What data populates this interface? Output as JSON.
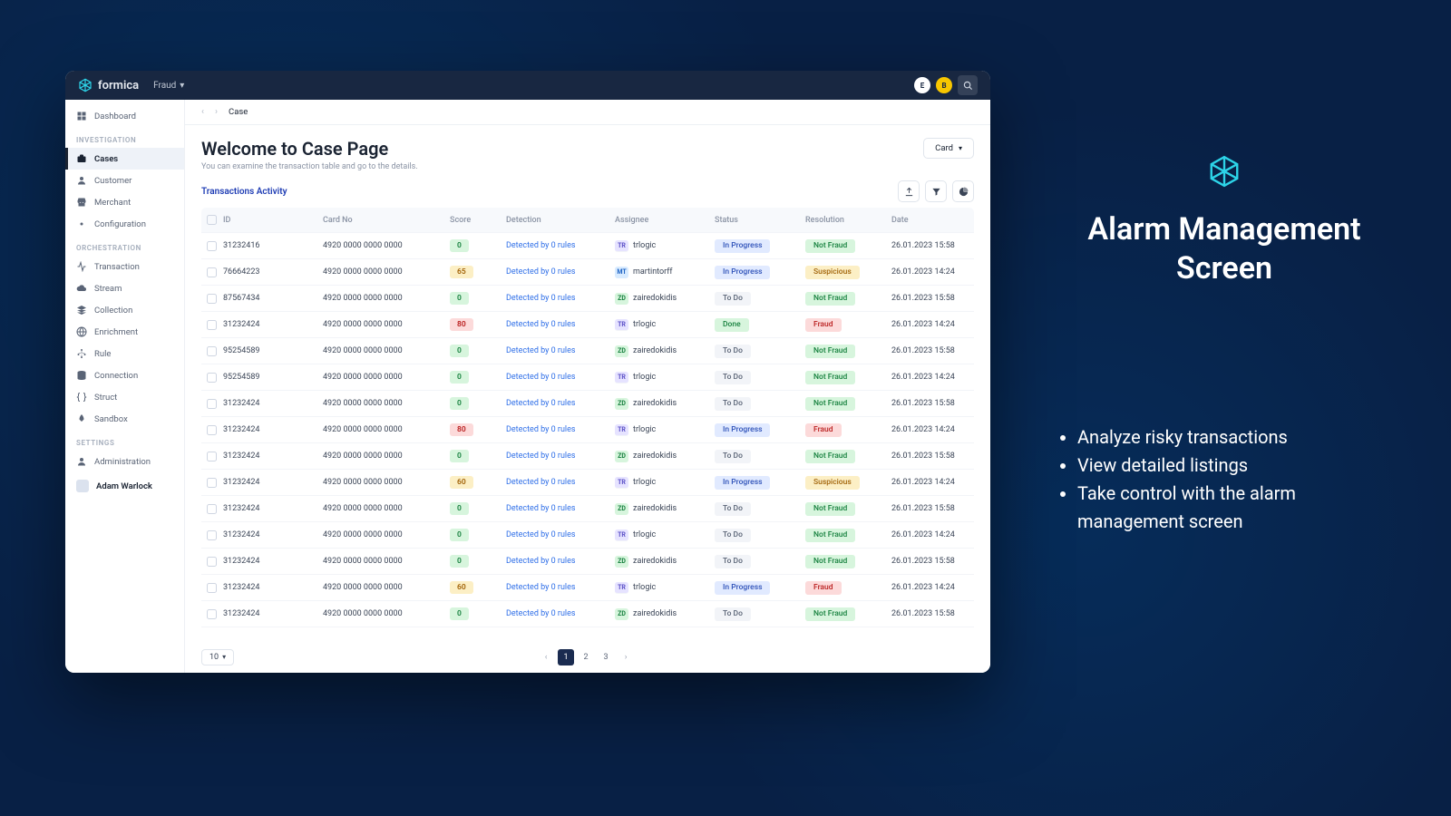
{
  "brand": "formica",
  "top_menu": {
    "label": "Fraud"
  },
  "topbar_pills": [
    "E",
    "B"
  ],
  "sidebar": {
    "groups": [
      {
        "header": null,
        "items": [
          {
            "label": "Dashboard",
            "icon": "dashboard"
          }
        ]
      },
      {
        "header": "INVESTIGATION",
        "items": [
          {
            "label": "Cases",
            "icon": "briefcase",
            "active": true
          },
          {
            "label": "Customer",
            "icon": "user"
          },
          {
            "label": "Merchant",
            "icon": "store"
          },
          {
            "label": "Configuration",
            "icon": "gear"
          }
        ]
      },
      {
        "header": "ORCHESTRATION",
        "items": [
          {
            "label": "Transaction",
            "icon": "activity"
          },
          {
            "label": "Stream",
            "icon": "cloud"
          },
          {
            "label": "Collection",
            "icon": "layers"
          },
          {
            "label": "Enrichment",
            "icon": "globe"
          },
          {
            "label": "Rule",
            "icon": "tree"
          },
          {
            "label": "Connection",
            "icon": "db"
          },
          {
            "label": "Struct",
            "icon": "braces"
          },
          {
            "label": "Sandbox",
            "icon": "rocket"
          }
        ]
      },
      {
        "header": "SETTINGS",
        "items": [
          {
            "label": "Administration",
            "icon": "user"
          }
        ]
      }
    ],
    "user": "Adam Warlock"
  },
  "breadcrumb": "Case",
  "page": {
    "title": "Welcome to Case Page",
    "subtitle": "You can examine the transaction table and go to the details.",
    "dropdown": "Card"
  },
  "section_title": "Transactions Activity",
  "columns": [
    "ID",
    "Card No",
    "Score",
    "Detection",
    "Assignee",
    "Status",
    "Resolution",
    "Date"
  ],
  "rows": [
    {
      "id": "31232416",
      "card": "4920 0000 0000 0000",
      "score": 0,
      "score_cls": "g",
      "detect": "Detected by 0 rules",
      "assignee": {
        "tag": "TR",
        "cls": "tr",
        "name": "trlogic"
      },
      "status": {
        "label": "In Progress",
        "cls": "progress"
      },
      "res": {
        "label": "Not Fraud",
        "cls": "notfraud"
      },
      "date": "26.01.2023 15:58"
    },
    {
      "id": "76664223",
      "card": "4920 0000 0000 0000",
      "score": 65,
      "score_cls": "y",
      "detect": "Detected by 0 rules",
      "assignee": {
        "tag": "MT",
        "cls": "mt",
        "name": "martintorff"
      },
      "status": {
        "label": "In Progress",
        "cls": "progress"
      },
      "res": {
        "label": "Suspicious",
        "cls": "suspicious"
      },
      "date": "26.01.2023 14:24"
    },
    {
      "id": "87567434",
      "card": "4920 0000 0000 0000",
      "score": 0,
      "score_cls": "g",
      "detect": "Detected by 0 rules",
      "assignee": {
        "tag": "ZD",
        "cls": "zd",
        "name": "zairedokidis"
      },
      "status": {
        "label": "To Do",
        "cls": "todo"
      },
      "res": {
        "label": "Not Fraud",
        "cls": "notfraud"
      },
      "date": "26.01.2023 15:58"
    },
    {
      "id": "31232424",
      "card": "4920 0000 0000 0000",
      "score": 80,
      "score_cls": "r",
      "detect": "Detected by 0 rules",
      "assignee": {
        "tag": "TR",
        "cls": "tr",
        "name": "trlogic"
      },
      "status": {
        "label": "Done",
        "cls": "done"
      },
      "res": {
        "label": "Fraud",
        "cls": "fraud"
      },
      "date": "26.01.2023 14:24"
    },
    {
      "id": "95254589",
      "card": "4920 0000 0000 0000",
      "score": 0,
      "score_cls": "g",
      "detect": "Detected by 0 rules",
      "assignee": {
        "tag": "ZD",
        "cls": "zd",
        "name": "zairedokidis"
      },
      "status": {
        "label": "To Do",
        "cls": "todo"
      },
      "res": {
        "label": "Not Fraud",
        "cls": "notfraud"
      },
      "date": "26.01.2023 15:58"
    },
    {
      "id": "95254589",
      "card": "4920 0000 0000 0000",
      "score": 0,
      "score_cls": "g",
      "detect": "Detected by 0 rules",
      "assignee": {
        "tag": "TR",
        "cls": "tr",
        "name": "trlogic"
      },
      "status": {
        "label": "To Do",
        "cls": "todo"
      },
      "res": {
        "label": "Not Fraud",
        "cls": "notfraud"
      },
      "date": "26.01.2023 14:24"
    },
    {
      "id": "31232424",
      "card": "4920 0000 0000 0000",
      "score": 0,
      "score_cls": "g",
      "detect": "Detected by 0 rules",
      "assignee": {
        "tag": "ZD",
        "cls": "zd",
        "name": "zairedokidis"
      },
      "status": {
        "label": "To Do",
        "cls": "todo"
      },
      "res": {
        "label": "Not Fraud",
        "cls": "notfraud"
      },
      "date": "26.01.2023 15:58"
    },
    {
      "id": "31232424",
      "card": "4920 0000 0000 0000",
      "score": 80,
      "score_cls": "r",
      "detect": "Detected by 0 rules",
      "assignee": {
        "tag": "TR",
        "cls": "tr",
        "name": "trlogic"
      },
      "status": {
        "label": "In Progress",
        "cls": "progress"
      },
      "res": {
        "label": "Fraud",
        "cls": "fraud"
      },
      "date": "26.01.2023 14:24"
    },
    {
      "id": "31232424",
      "card": "4920 0000 0000 0000",
      "score": 0,
      "score_cls": "g",
      "detect": "Detected by 0 rules",
      "assignee": {
        "tag": "ZD",
        "cls": "zd",
        "name": "zairedokidis"
      },
      "status": {
        "label": "To Do",
        "cls": "todo"
      },
      "res": {
        "label": "Not Fraud",
        "cls": "notfraud"
      },
      "date": "26.01.2023 15:58"
    },
    {
      "id": "31232424",
      "card": "4920 0000 0000 0000",
      "score": 60,
      "score_cls": "y",
      "detect": "Detected by 0 rules",
      "assignee": {
        "tag": "TR",
        "cls": "tr",
        "name": "trlogic"
      },
      "status": {
        "label": "In Progress",
        "cls": "progress"
      },
      "res": {
        "label": "Suspicious",
        "cls": "suspicious"
      },
      "date": "26.01.2023 14:24"
    },
    {
      "id": "31232424",
      "card": "4920 0000 0000 0000",
      "score": 0,
      "score_cls": "g",
      "detect": "Detected by 0 rules",
      "assignee": {
        "tag": "ZD",
        "cls": "zd",
        "name": "zairedokidis"
      },
      "status": {
        "label": "To Do",
        "cls": "todo"
      },
      "res": {
        "label": "Not Fraud",
        "cls": "notfraud"
      },
      "date": "26.01.2023 15:58"
    },
    {
      "id": "31232424",
      "card": "4920 0000 0000 0000",
      "score": 0,
      "score_cls": "g",
      "detect": "Detected by 0 rules",
      "assignee": {
        "tag": "TR",
        "cls": "tr",
        "name": "trlogic"
      },
      "status": {
        "label": "To Do",
        "cls": "todo"
      },
      "res": {
        "label": "Not Fraud",
        "cls": "notfraud"
      },
      "date": "26.01.2023 14:24"
    },
    {
      "id": "31232424",
      "card": "4920 0000 0000 0000",
      "score": 0,
      "score_cls": "g",
      "detect": "Detected by 0 rules",
      "assignee": {
        "tag": "ZD",
        "cls": "zd",
        "name": "zairedokidis"
      },
      "status": {
        "label": "To Do",
        "cls": "todo"
      },
      "res": {
        "label": "Not Fraud",
        "cls": "notfraud"
      },
      "date": "26.01.2023 15:58"
    },
    {
      "id": "31232424",
      "card": "4920 0000 0000 0000",
      "score": 60,
      "score_cls": "y",
      "detect": "Detected by 0 rules",
      "assignee": {
        "tag": "TR",
        "cls": "tr",
        "name": "trlogic"
      },
      "status": {
        "label": "In Progress",
        "cls": "progress"
      },
      "res": {
        "label": "Fraud",
        "cls": "fraud"
      },
      "date": "26.01.2023 14:24"
    },
    {
      "id": "31232424",
      "card": "4920 0000 0000 0000",
      "score": 0,
      "score_cls": "g",
      "detect": "Detected by 0 rules",
      "assignee": {
        "tag": "ZD",
        "cls": "zd",
        "name": "zairedokidis"
      },
      "status": {
        "label": "To Do",
        "cls": "todo"
      },
      "res": {
        "label": "Not Fraud",
        "cls": "notfraud"
      },
      "date": "26.01.2023 15:58"
    }
  ],
  "pagination": {
    "size": "10",
    "pages": [
      "1",
      "2",
      "3"
    ],
    "active": 0
  },
  "promo": {
    "heading": "Alarm Management Screen",
    "bullets": [
      "Analyze risky transactions",
      "View detailed listings",
      "Take control with the alarm management screen"
    ]
  }
}
